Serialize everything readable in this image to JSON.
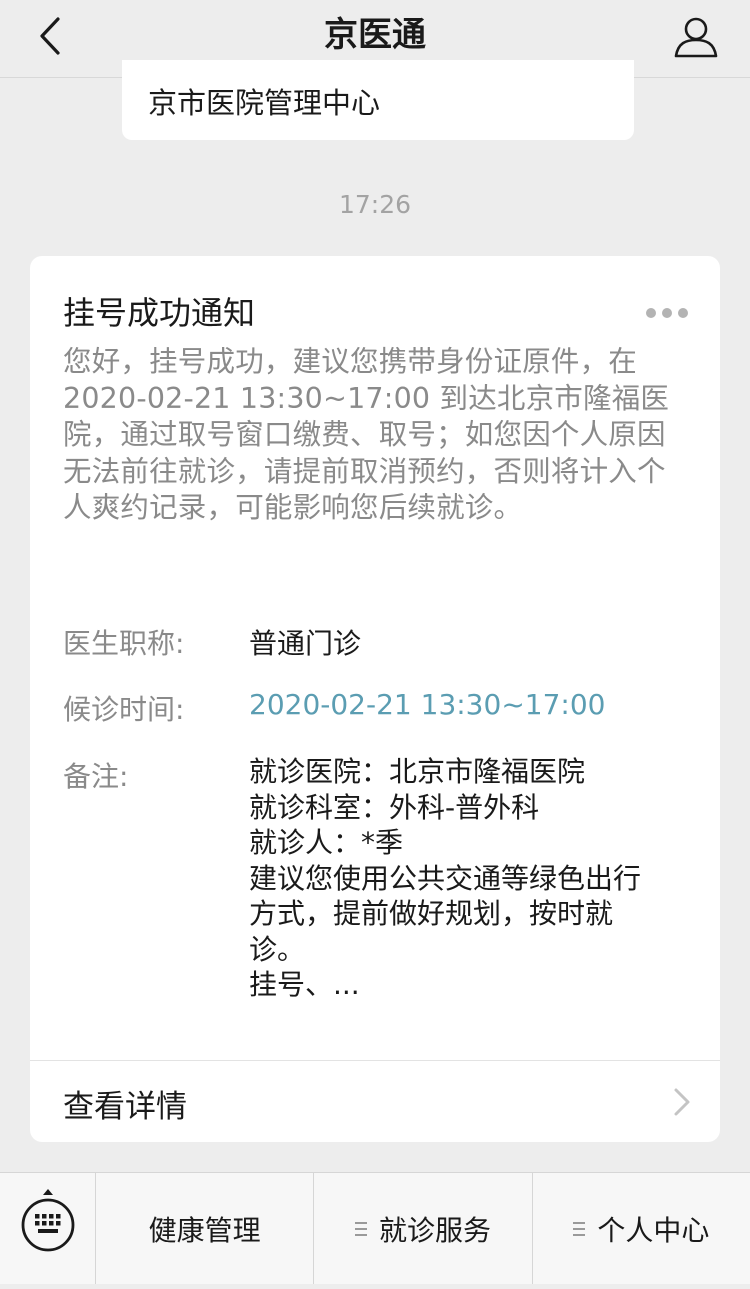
{
  "header": {
    "title": "京医通",
    "back_icon": "chevron-left-icon",
    "user_icon": "user-icon"
  },
  "previous_message": {
    "text": "京市医院管理中心"
  },
  "timestamp": "17:26",
  "card": {
    "title": "挂号成功通知",
    "intro": "您好，挂号成功，建议您携带身份证原件，在2020-02-21 13:30~17:00 到达北京市隆福医院，通过取号窗口缴费、取号；如您因个人原因无法前往就诊，请提前取消预约，否则将计入个人爽约记录，可能影响您后续就诊。",
    "fields": {
      "doctor_title_label": "医生职称:",
      "doctor_title_value": "普通门诊",
      "wait_time_label": "候诊时间:",
      "wait_time_value": "2020-02-21 13:30~17:00",
      "note_label": "备注:",
      "note_lines": [
        "就诊医院：北京市隆福医院",
        "就诊科室：外科-普外科",
        "就诊人：*季",
        "建议您使用公共交通等绿色出行",
        "方式，提前做好规划，按时就",
        "诊。",
        "挂号、..."
      ]
    },
    "detail_label": "查看详情",
    "link_color": "#5b9db2"
  },
  "bottom_menu": {
    "keyboard_icon": "keyboard-icon",
    "items": [
      "健康管理",
      "就诊服务",
      "个人中心"
    ]
  }
}
